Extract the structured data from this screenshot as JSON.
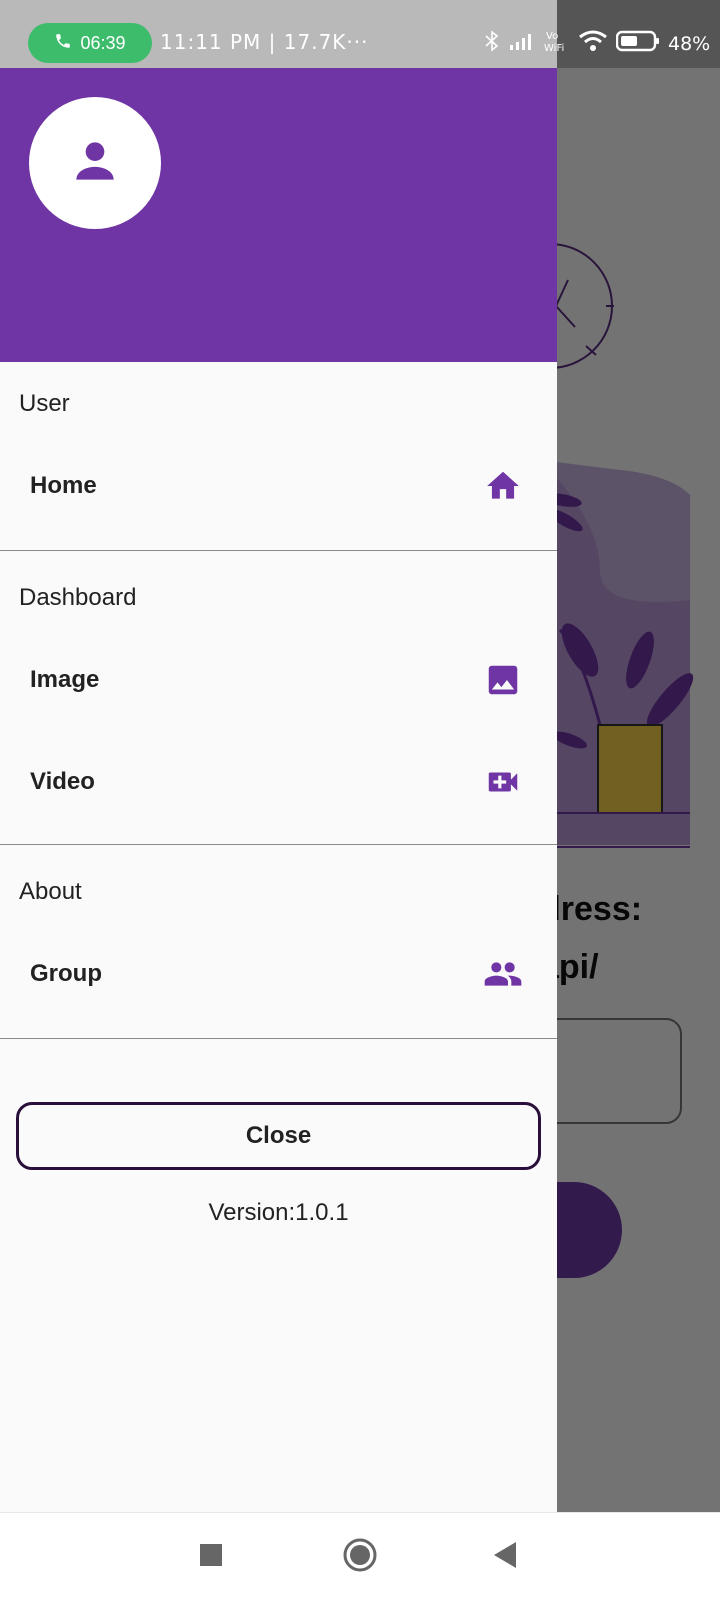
{
  "status_bar": {
    "call_duration": "06:39",
    "time_text": "11:11 PM | 17.7K···",
    "battery_percent": "48%",
    "icons": [
      "phone-icon",
      "bluetooth-icon",
      "signal-icon",
      "vowifi-icon",
      "wifi-icon",
      "battery-icon"
    ]
  },
  "background_app": {
    "heading_line1": "dress:",
    "heading_line2": "api/"
  },
  "drawer": {
    "header_color": "#6f35a5",
    "avatar_icon": "person-icon",
    "sections": [
      {
        "title": "User",
        "items": [
          {
            "label": "Home",
            "icon": "home-icon"
          }
        ]
      },
      {
        "title": "Dashboard",
        "items": [
          {
            "label": "Image",
            "icon": "image-icon"
          },
          {
            "label": "Video",
            "icon": "video-add-icon"
          }
        ]
      },
      {
        "title": "About",
        "items": [
          {
            "label": "Group",
            "icon": "group-icon"
          }
        ]
      }
    ],
    "close_label": "Close",
    "version": "Version:1.0.1"
  },
  "nav_bar": {
    "icons": [
      "recents-icon",
      "home-circle-icon",
      "back-icon"
    ]
  },
  "colors": {
    "accent": "#6f35a5",
    "icon": "#6f35a5",
    "close_border": "#2a0f3b"
  }
}
